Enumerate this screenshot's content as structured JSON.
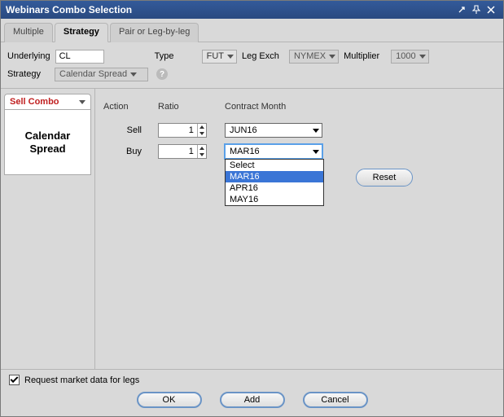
{
  "window": {
    "title": "Webinars Combo Selection"
  },
  "tabs": [
    {
      "label": "Multiple"
    },
    {
      "label": "Strategy"
    },
    {
      "label": "Pair or Leg-by-leg"
    }
  ],
  "form": {
    "underlying_label": "Underlying",
    "underlying_value": "CL",
    "type_label": "Type",
    "type_value": "FUT",
    "leg_exch_label": "Leg Exch",
    "leg_exch_value": "NYMEX",
    "multiplier_label": "Multiplier",
    "multiplier_value": "1000",
    "strategy_label": "Strategy",
    "strategy_value": "Calendar Spread"
  },
  "side_panel": {
    "tab_label": "Sell Combo",
    "strategy_name": "Calendar Spread"
  },
  "grid": {
    "headers": {
      "action": "Action",
      "ratio": "Ratio",
      "month": "Contract Month"
    },
    "rows": [
      {
        "action": "Sell",
        "ratio": "1",
        "month": "JUN16"
      },
      {
        "action": "Buy",
        "ratio": "1",
        "month": "MAR16"
      }
    ],
    "reset": "Reset"
  },
  "dropdown_open": {
    "items": [
      "Select",
      "MAR16",
      "APR16",
      "MAY16"
    ],
    "selected_index": 1
  },
  "footer": {
    "checkbox_label": "Request market data for legs",
    "ok": "OK",
    "add": "Add",
    "cancel": "Cancel"
  }
}
